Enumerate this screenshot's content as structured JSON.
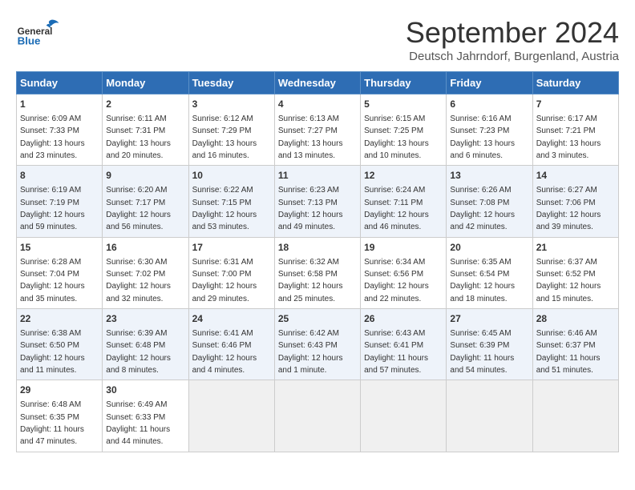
{
  "header": {
    "logo_general": "General",
    "logo_blue": "Blue",
    "main_title": "September 2024",
    "subtitle": "Deutsch Jahrndorf, Burgenland, Austria"
  },
  "calendar": {
    "weekdays": [
      "Sunday",
      "Monday",
      "Tuesday",
      "Wednesday",
      "Thursday",
      "Friday",
      "Saturday"
    ],
    "weeks": [
      [
        {
          "day": "1",
          "sunrise": "6:09 AM",
          "sunset": "7:33 PM",
          "daylight": "13 hours and 23 minutes."
        },
        {
          "day": "2",
          "sunrise": "6:11 AM",
          "sunset": "7:31 PM",
          "daylight": "13 hours and 20 minutes."
        },
        {
          "day": "3",
          "sunrise": "6:12 AM",
          "sunset": "7:29 PM",
          "daylight": "13 hours and 16 minutes."
        },
        {
          "day": "4",
          "sunrise": "6:13 AM",
          "sunset": "7:27 PM",
          "daylight": "13 hours and 13 minutes."
        },
        {
          "day": "5",
          "sunrise": "6:15 AM",
          "sunset": "7:25 PM",
          "daylight": "13 hours and 10 minutes."
        },
        {
          "day": "6",
          "sunrise": "6:16 AM",
          "sunset": "7:23 PM",
          "daylight": "13 hours and 6 minutes."
        },
        {
          "day": "7",
          "sunrise": "6:17 AM",
          "sunset": "7:21 PM",
          "daylight": "13 hours and 3 minutes."
        }
      ],
      [
        {
          "day": "8",
          "sunrise": "6:19 AM",
          "sunset": "7:19 PM",
          "daylight": "12 hours and 59 minutes."
        },
        {
          "day": "9",
          "sunrise": "6:20 AM",
          "sunset": "7:17 PM",
          "daylight": "12 hours and 56 minutes."
        },
        {
          "day": "10",
          "sunrise": "6:22 AM",
          "sunset": "7:15 PM",
          "daylight": "12 hours and 53 minutes."
        },
        {
          "day": "11",
          "sunrise": "6:23 AM",
          "sunset": "7:13 PM",
          "daylight": "12 hours and 49 minutes."
        },
        {
          "day": "12",
          "sunrise": "6:24 AM",
          "sunset": "7:11 PM",
          "daylight": "12 hours and 46 minutes."
        },
        {
          "day": "13",
          "sunrise": "6:26 AM",
          "sunset": "7:08 PM",
          "daylight": "12 hours and 42 minutes."
        },
        {
          "day": "14",
          "sunrise": "6:27 AM",
          "sunset": "7:06 PM",
          "daylight": "12 hours and 39 minutes."
        }
      ],
      [
        {
          "day": "15",
          "sunrise": "6:28 AM",
          "sunset": "7:04 PM",
          "daylight": "12 hours and 35 minutes."
        },
        {
          "day": "16",
          "sunrise": "6:30 AM",
          "sunset": "7:02 PM",
          "daylight": "12 hours and 32 minutes."
        },
        {
          "day": "17",
          "sunrise": "6:31 AM",
          "sunset": "7:00 PM",
          "daylight": "12 hours and 29 minutes."
        },
        {
          "day": "18",
          "sunrise": "6:32 AM",
          "sunset": "6:58 PM",
          "daylight": "12 hours and 25 minutes."
        },
        {
          "day": "19",
          "sunrise": "6:34 AM",
          "sunset": "6:56 PM",
          "daylight": "12 hours and 22 minutes."
        },
        {
          "day": "20",
          "sunrise": "6:35 AM",
          "sunset": "6:54 PM",
          "daylight": "12 hours and 18 minutes."
        },
        {
          "day": "21",
          "sunrise": "6:37 AM",
          "sunset": "6:52 PM",
          "daylight": "12 hours and 15 minutes."
        }
      ],
      [
        {
          "day": "22",
          "sunrise": "6:38 AM",
          "sunset": "6:50 PM",
          "daylight": "12 hours and 11 minutes."
        },
        {
          "day": "23",
          "sunrise": "6:39 AM",
          "sunset": "6:48 PM",
          "daylight": "12 hours and 8 minutes."
        },
        {
          "day": "24",
          "sunrise": "6:41 AM",
          "sunset": "6:46 PM",
          "daylight": "12 hours and 4 minutes."
        },
        {
          "day": "25",
          "sunrise": "6:42 AM",
          "sunset": "6:43 PM",
          "daylight": "12 hours and 1 minute."
        },
        {
          "day": "26",
          "sunrise": "6:43 AM",
          "sunset": "6:41 PM",
          "daylight": "11 hours and 57 minutes."
        },
        {
          "day": "27",
          "sunrise": "6:45 AM",
          "sunset": "6:39 PM",
          "daylight": "11 hours and 54 minutes."
        },
        {
          "day": "28",
          "sunrise": "6:46 AM",
          "sunset": "6:37 PM",
          "daylight": "11 hours and 51 minutes."
        }
      ],
      [
        {
          "day": "29",
          "sunrise": "6:48 AM",
          "sunset": "6:35 PM",
          "daylight": "11 hours and 47 minutes."
        },
        {
          "day": "30",
          "sunrise": "6:49 AM",
          "sunset": "6:33 PM",
          "daylight": "11 hours and 44 minutes."
        },
        null,
        null,
        null,
        null,
        null
      ]
    ]
  }
}
